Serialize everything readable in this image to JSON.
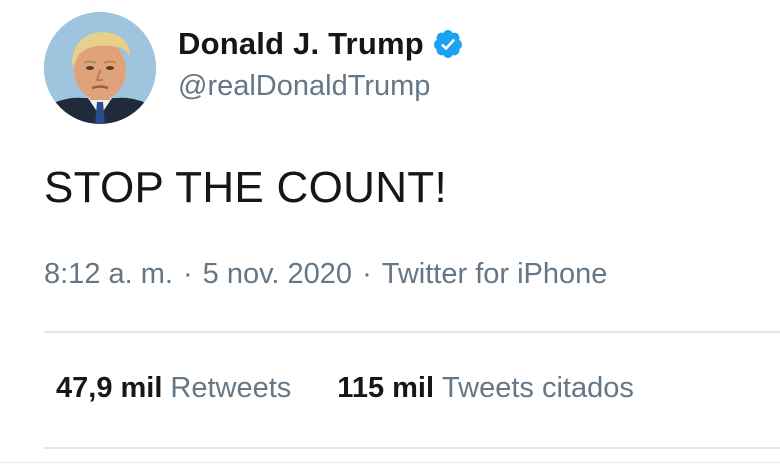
{
  "user": {
    "display_name": "Donald J. Trump",
    "handle": "@realDonaldTrump",
    "verified": true,
    "verified_icon": "verified-badge-icon",
    "avatar": "profile-photo"
  },
  "tweet": {
    "text": "STOP THE COUNT!",
    "time": "8:12 a. m.",
    "date": "5 nov. 2020",
    "source": "Twitter for iPhone",
    "separator": "·"
  },
  "stats": {
    "retweets_count": "47,9 mil",
    "retweets_label": "Retweets",
    "quotes_count": "115 mil",
    "quotes_label": "Tweets citados"
  },
  "colors": {
    "primary_text": "#14171a",
    "secondary_text": "#657786",
    "verified_blue": "#1da1f2",
    "divider": "#e1e8ed"
  }
}
